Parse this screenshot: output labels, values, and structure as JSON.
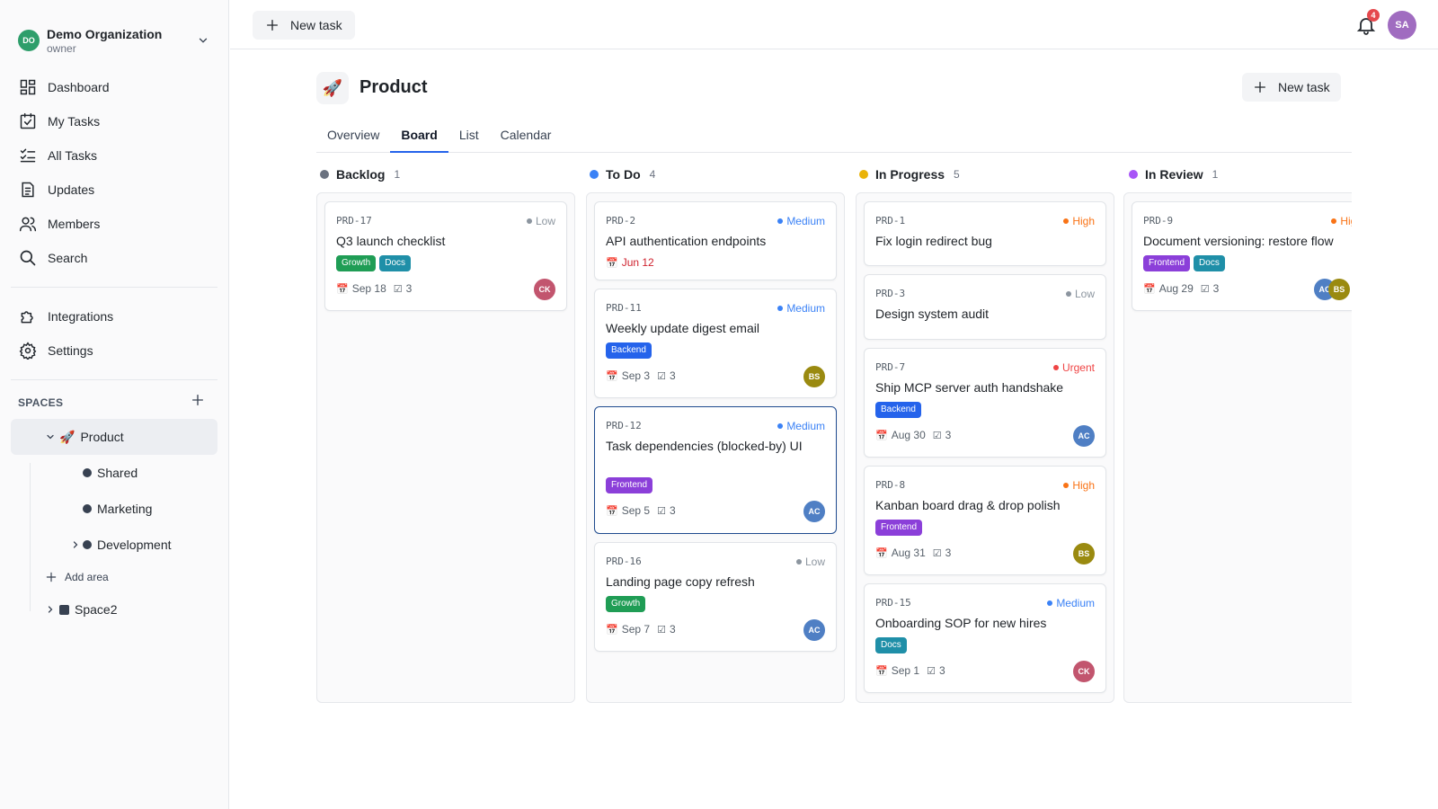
{
  "org": {
    "initials": "DO",
    "name": "Demo Organization",
    "role": "owner"
  },
  "nav": [
    {
      "label": "Dashboard",
      "icon": "dashboard-icon"
    },
    {
      "label": "My Tasks",
      "icon": "checkbox-icon"
    },
    {
      "label": "All Tasks",
      "icon": "list-checks-icon"
    },
    {
      "label": "Updates",
      "icon": "document-icon"
    },
    {
      "label": "Members",
      "icon": "users-icon"
    },
    {
      "label": "Search",
      "icon": "search-icon"
    }
  ],
  "nav2": [
    {
      "label": "Integrations",
      "icon": "puzzle-icon"
    },
    {
      "label": "Settings",
      "icon": "gear-icon"
    }
  ],
  "spaces": {
    "title": "SPACES",
    "product": "Product",
    "product_emoji": "🚀",
    "shared": "Shared",
    "marketing": "Marketing",
    "development": "Development",
    "add_area": "Add area",
    "space2": "Space2"
  },
  "topbar": {
    "new_task": "New task",
    "notifications": "4",
    "user_initials": "SA"
  },
  "project": {
    "emoji": "🚀",
    "title": "Product",
    "new_task": "New task"
  },
  "tabs": [
    "Overview",
    "Board",
    "List",
    "Calendar"
  ],
  "columns": [
    {
      "title": "Backlog",
      "count": "1",
      "color": "#6b7280"
    },
    {
      "title": "To Do",
      "count": "4",
      "color": "#3b82f6"
    },
    {
      "title": "In Progress",
      "count": "5",
      "color": "#eab308"
    },
    {
      "title": "In Review",
      "count": "1",
      "color": "#a855f7"
    }
  ],
  "cards": {
    "prd17": {
      "id": "PRD-17",
      "priority": "Low",
      "title": "Q3 launch checklist",
      "tag1": "Growth",
      "tag2": "Docs",
      "date": "Sep 18",
      "checks": "3",
      "assignee": "CK"
    },
    "prd2": {
      "id": "PRD-2",
      "priority": "Medium",
      "title": "API authentication endpoints",
      "date": "Jun 12"
    },
    "prd11": {
      "id": "PRD-11",
      "priority": "Medium",
      "title": "Weekly update digest email",
      "tag1": "Backend",
      "date": "Sep 3",
      "checks": "3",
      "assignee": "BS"
    },
    "prd12": {
      "id": "PRD-12",
      "priority": "Medium",
      "title": "Task dependencies (blocked-by) UI",
      "tag1": "Frontend",
      "date": "Sep 5",
      "checks": "3",
      "assignee": "AC"
    },
    "prd16": {
      "id": "PRD-16",
      "priority": "Low",
      "title": "Landing page copy refresh",
      "tag1": "Growth",
      "date": "Sep 7",
      "checks": "3",
      "assignee": "AC"
    },
    "prd1": {
      "id": "PRD-1",
      "priority": "High",
      "title": "Fix login redirect bug"
    },
    "prd3": {
      "id": "PRD-3",
      "priority": "Low",
      "title": "Design system audit"
    },
    "prd7": {
      "id": "PRD-7",
      "priority": "Urgent",
      "title": "Ship MCP server auth handshake",
      "tag1": "Backend",
      "date": "Aug 30",
      "checks": "3",
      "assignee": "AC"
    },
    "prd8": {
      "id": "PRD-8",
      "priority": "High",
      "title": "Kanban board drag & drop polish",
      "tag1": "Frontend",
      "date": "Aug 31",
      "checks": "3",
      "assignee": "BS"
    },
    "prd15": {
      "id": "PRD-15",
      "priority": "Medium",
      "title": "Onboarding SOP for new hires",
      "tag1": "Docs",
      "date": "Sep 1",
      "checks": "3",
      "assignee": "CK"
    },
    "prd9": {
      "id": "PRD-9",
      "priority": "High",
      "title": "Document versioning: restore flow",
      "tag1": "Frontend",
      "tag2": "Docs",
      "date": "Aug 29",
      "checks": "3",
      "assignee": "AC",
      "assignee2": "BS"
    }
  },
  "colors": {
    "low": "#8c959f",
    "medium": "#3b82f6",
    "high": "#f97316",
    "urgent": "#ef4444",
    "growth": "#1f9d55",
    "docs": "#1f8fa8",
    "backend": "#2563eb",
    "frontend": "#8b3fd9",
    "av_ck": "#c2556e",
    "av_bs": "#9a8a10",
    "av_ac": "#4f7fc4"
  }
}
